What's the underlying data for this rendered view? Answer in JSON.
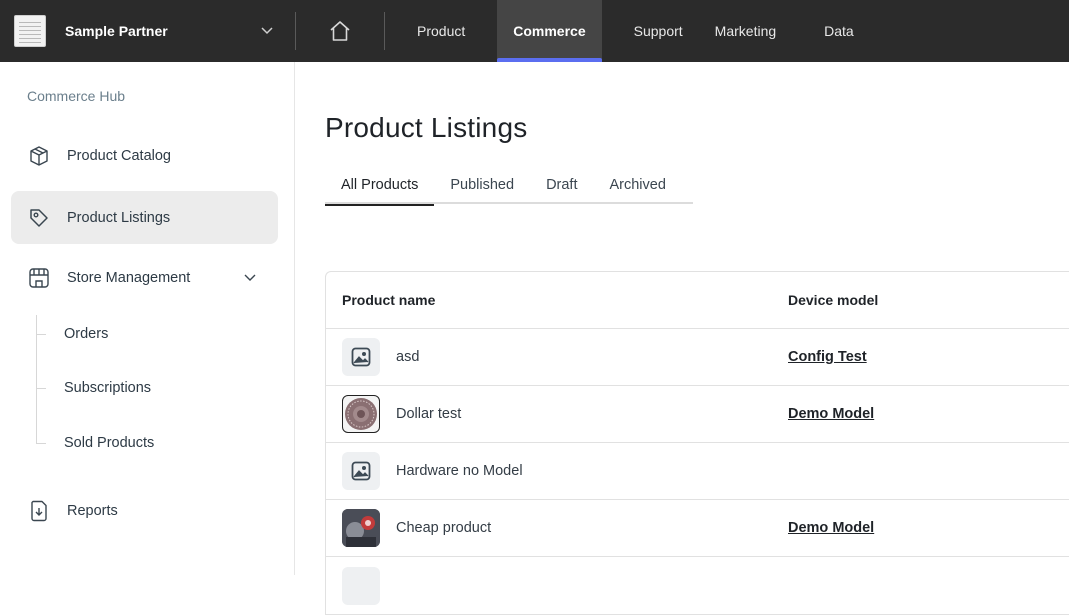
{
  "topbar": {
    "org_name": "Sample Partner",
    "nav": [
      {
        "label": "Product",
        "active": false
      },
      {
        "label": "Commerce",
        "active": true
      },
      {
        "label": "Support",
        "active": false
      },
      {
        "label": "Marketing",
        "active": false
      },
      {
        "label": "Data",
        "active": false
      }
    ],
    "accent_color": "#5b6ef0"
  },
  "sidebar": {
    "hub_label": "Commerce Hub",
    "items": [
      {
        "label": "Product Catalog",
        "icon": "box-icon"
      },
      {
        "label": "Product Listings",
        "icon": "tag-icon",
        "active": true
      },
      {
        "label": "Store Management",
        "icon": "store-icon",
        "expanded": true
      },
      {
        "label": "Reports",
        "icon": "report-download-icon"
      }
    ],
    "sub_items": [
      "Orders",
      "Subscriptions",
      "Sold Products"
    ]
  },
  "main": {
    "title": "Product Listings",
    "tabs": [
      {
        "label": "All Products",
        "active": true
      },
      {
        "label": "Published"
      },
      {
        "label": "Draft"
      },
      {
        "label": "Archived"
      }
    ],
    "table": {
      "headers": {
        "name": "Product name",
        "model": "Device model"
      },
      "rows": [
        {
          "name": "asd",
          "model": "Config Test",
          "thumb": "placeholder-image-icon"
        },
        {
          "name": "Dollar test",
          "model": "Demo Model",
          "thumb": "coin-photo"
        },
        {
          "name": "Hardware no Model",
          "model": "",
          "thumb": "placeholder-image-icon"
        },
        {
          "name": "Cheap product",
          "model": "Demo Model",
          "thumb": "product-photo"
        }
      ]
    }
  }
}
